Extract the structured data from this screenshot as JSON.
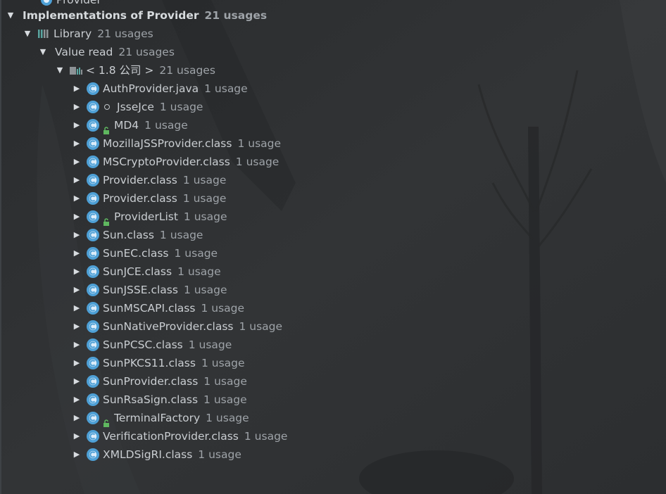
{
  "top_cut_label": "Provider",
  "root": {
    "label": "Implementations of Provider",
    "count": "21 usages"
  },
  "library": {
    "label": "Library",
    "count": "21 usages"
  },
  "value_read": {
    "label": "Value read",
    "count": "21 usages"
  },
  "jdk": {
    "label": "< 1.8 公司 >",
    "count": "21 usages"
  },
  "items": [
    {
      "label": "AuthProvider.java",
      "count": "1 usage",
      "mod": "none"
    },
    {
      "label": "JsseJce",
      "count": "1 usage",
      "mod": "dot"
    },
    {
      "label": "MD4",
      "count": "1 usage",
      "mod": "lock"
    },
    {
      "label": "MozillaJSSProvider.class",
      "count": "1 usage",
      "mod": "none"
    },
    {
      "label": "MSCryptoProvider.class",
      "count": "1 usage",
      "mod": "none"
    },
    {
      "label": "Provider.class",
      "count": "1 usage",
      "mod": "none"
    },
    {
      "label": "Provider.class",
      "count": "1 usage",
      "mod": "none"
    },
    {
      "label": "ProviderList",
      "count": "1 usage",
      "mod": "lock"
    },
    {
      "label": "Sun.class",
      "count": "1 usage",
      "mod": "none"
    },
    {
      "label": "SunEC.class",
      "count": "1 usage",
      "mod": "none"
    },
    {
      "label": "SunJCE.class",
      "count": "1 usage",
      "mod": "none"
    },
    {
      "label": "SunJSSE.class",
      "count": "1 usage",
      "mod": "none"
    },
    {
      "label": "SunMSCAPI.class",
      "count": "1 usage",
      "mod": "none"
    },
    {
      "label": "SunNativeProvider.class",
      "count": "1 usage",
      "mod": "none"
    },
    {
      "label": "SunPCSC.class",
      "count": "1 usage",
      "mod": "none"
    },
    {
      "label": "SunPKCS11.class",
      "count": "1 usage",
      "mod": "none"
    },
    {
      "label": "SunProvider.class",
      "count": "1 usage",
      "mod": "none"
    },
    {
      "label": "SunRsaSign.class",
      "count": "1 usage",
      "mod": "none"
    },
    {
      "label": "TerminalFactory",
      "count": "1 usage",
      "mod": "lock"
    },
    {
      "label": "VerificationProvider.class",
      "count": "1 usage",
      "mod": "none"
    },
    {
      "label": "XMLDSigRI.class",
      "count": "1 usage",
      "mod": "none"
    }
  ],
  "colors": {
    "class_icon_blue": "#4ea0d6",
    "lock_green": "#5fb85f",
    "library_bar_teal": "#5aa5a0"
  }
}
